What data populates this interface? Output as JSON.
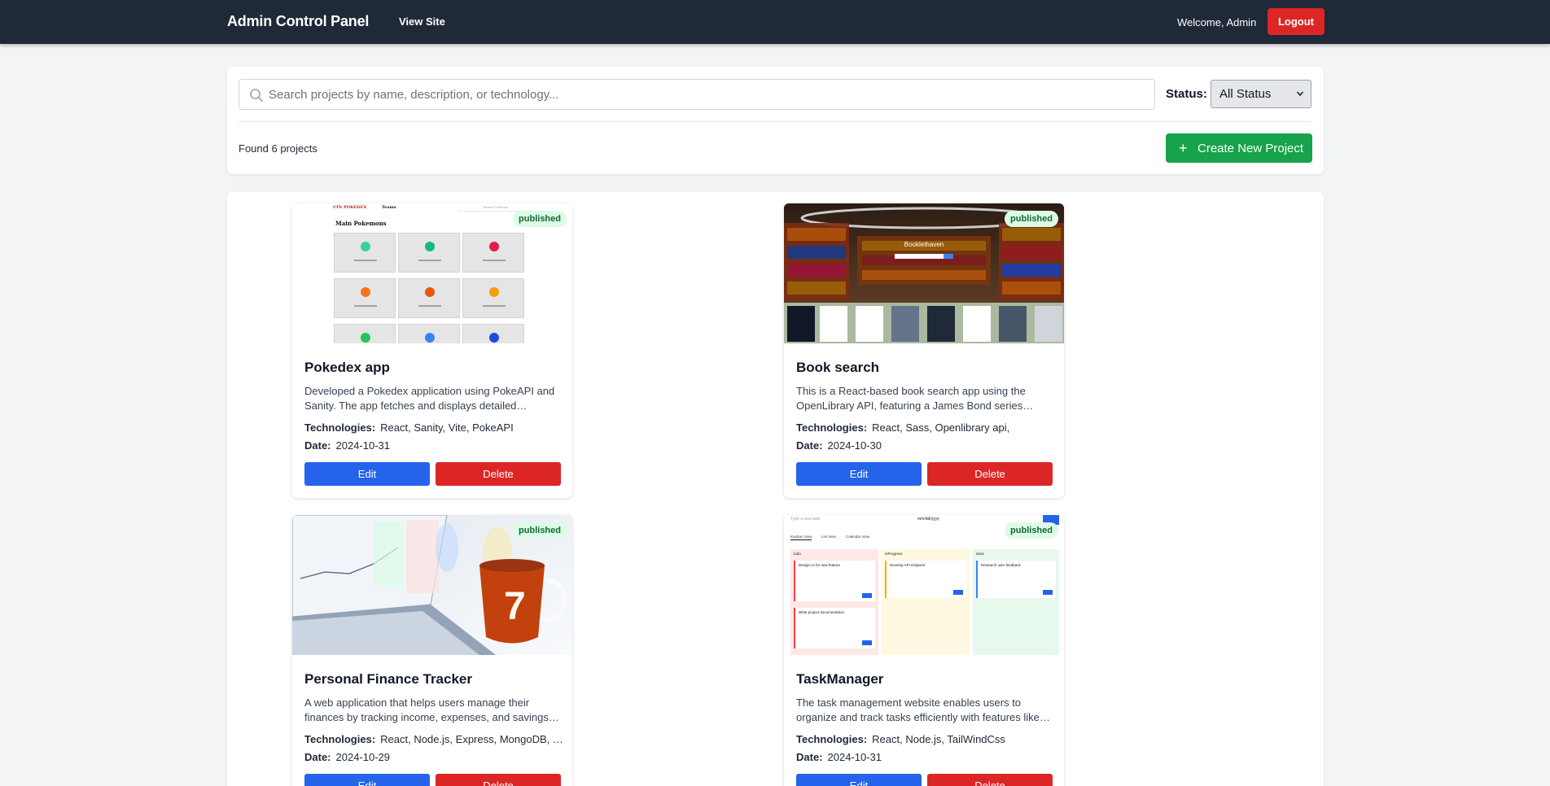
{
  "header": {
    "brand": "Admin Control Panel",
    "view_site": "View Site",
    "welcome": "Welcome, Admin",
    "logout": "Logout"
  },
  "filters": {
    "search_placeholder": "Search projects by name, description, or technology...",
    "search_value": "",
    "status_label": "Status:",
    "status_selected": "All Status",
    "found_text": "Found 6 projects",
    "create_label": "Create New Project"
  },
  "labels": {
    "technologies": "Technologies:",
    "date": "Date:",
    "edit": "Edit",
    "delete": "Delete"
  },
  "projects": [
    {
      "title": "Pokedex app",
      "status": "published",
      "description": "Developed a Pokedex application using PokeAPI and Sanity. The app fetches and displays detailed…",
      "technologies": "React, Sanity, Vite, PokeAPI",
      "date": "2024-10-31"
    },
    {
      "title": "Book search",
      "status": "published",
      "description": "This is a React-based book search app using the OpenLibrary API, featuring a James Bond series…",
      "technologies": "React, Sass, Openlibrary api,",
      "date": "2024-10-30"
    },
    {
      "title": "Personal Finance Tracker",
      "status": "published",
      "description": "A web application that helps users manage their finances by tracking income, expenses, and savings…",
      "technologies": "React, Node.js, Express, MongoDB, …",
      "date": "2024-10-29"
    },
    {
      "title": "TaskManager",
      "status": "published",
      "description": "The task management website enables users to organize and track tasks efficiently with features like…",
      "technologies": "React, Node.js, TailWindCss",
      "date": "2024-10-31"
    }
  ],
  "thumbnails": {
    "pokedex": {
      "brand": "UIN POKEDEX",
      "nav": "Teams",
      "search": "Search Pokemon",
      "heading": "Main Pokemons"
    },
    "book": {
      "logo": "Booklethaven"
    },
    "finance": {
      "mug_number": "7"
    },
    "task": {
      "input_placeholder": "Type a new task",
      "date_placeholder": "mm/dd/yyyy",
      "tabs": [
        "Kanban View",
        "List View",
        "Calendar View"
      ],
      "columns": [
        "todo",
        "inProgress",
        "done"
      ],
      "cards": [
        "Design UI for new feature",
        "Write project documentation",
        "Develop API endpoint",
        "Research user feedback"
      ]
    }
  },
  "colors": {
    "header_bg": "#1f2937",
    "danger": "#dc2626",
    "primary": "#2563eb",
    "success": "#16a34a",
    "badge_bg": "#dcfce7",
    "badge_text": "#166534"
  }
}
